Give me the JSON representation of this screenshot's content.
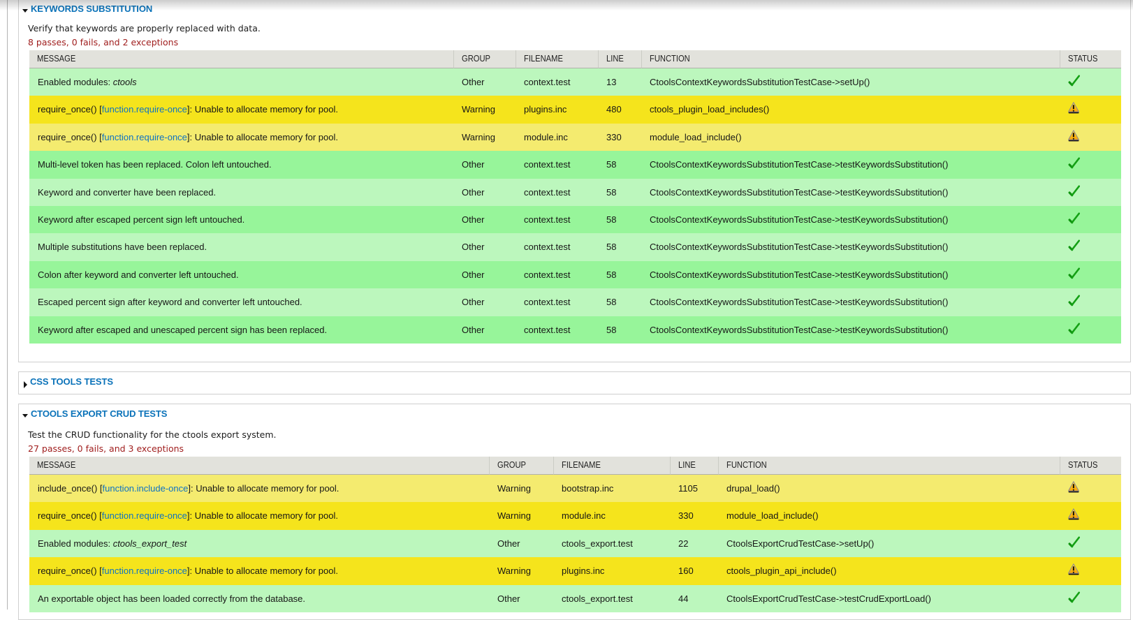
{
  "colors": {
    "pass_odd": "#bcf7bd",
    "pass_even": "#97f59a",
    "exception_odd": "#f4eb6f",
    "exception_even": "#f5e41c",
    "header_bg": "#e2e2dc",
    "title_blue": "#0a72b9",
    "link_blue": "#0d72c4",
    "summary_red": "#a01e1e",
    "check_green": "#1a9f1a",
    "warning_orange": "#f7a405"
  },
  "icons": {
    "expanded_arrow": "triangle-down",
    "collapsed_arrow": "triangle-right",
    "pass": "green-check",
    "exception": "yellow-warning-triangle"
  },
  "sections": [
    {
      "title": "KEYWORDS SUBSTITUTION",
      "collapsed": false,
      "description": "Verify that keywords are properly replaced with data.",
      "summary": "8 passes, 0 fails, and 2 exceptions",
      "columns": [
        "MESSAGE",
        "GROUP",
        "FILENAME",
        "LINE",
        "FUNCTION",
        "STATUS"
      ],
      "rows": [
        {
          "message": [
            {
              "t": "text",
              "v": "Enabled modules: "
            },
            {
              "t": "em",
              "v": "ctools"
            }
          ],
          "group": "Other",
          "filename": "context.test",
          "line": "13",
          "function": "CtoolsContextKeywordsSubstitutionTestCase->setUp()",
          "status": "pass"
        },
        {
          "message": [
            {
              "t": "text",
              "v": "require_once() ["
            },
            {
              "t": "link",
              "v": "function.require-once"
            },
            {
              "t": "text",
              "v": "]: Unable to allocate memory for pool."
            }
          ],
          "group": "Warning",
          "filename": "plugins.inc",
          "line": "480",
          "function": "ctools_plugin_load_includes()",
          "status": "exception"
        },
        {
          "message": [
            {
              "t": "text",
              "v": "require_once() ["
            },
            {
              "t": "link",
              "v": "function.require-once"
            },
            {
              "t": "text",
              "v": "]: Unable to allocate memory for pool."
            }
          ],
          "group": "Warning",
          "filename": "module.inc",
          "line": "330",
          "function": "module_load_include()",
          "status": "exception"
        },
        {
          "message": [
            {
              "t": "text",
              "v": "Multi-level token has been replaced. Colon left untouched."
            }
          ],
          "group": "Other",
          "filename": "context.test",
          "line": "58",
          "function": "CtoolsContextKeywordsSubstitutionTestCase->testKeywordsSubstitution()",
          "status": "pass"
        },
        {
          "message": [
            {
              "t": "text",
              "v": "Keyword and converter have been replaced."
            }
          ],
          "group": "Other",
          "filename": "context.test",
          "line": "58",
          "function": "CtoolsContextKeywordsSubstitutionTestCase->testKeywordsSubstitution()",
          "status": "pass"
        },
        {
          "message": [
            {
              "t": "text",
              "v": "Keyword after escaped percent sign left untouched."
            }
          ],
          "group": "Other",
          "filename": "context.test",
          "line": "58",
          "function": "CtoolsContextKeywordsSubstitutionTestCase->testKeywordsSubstitution()",
          "status": "pass"
        },
        {
          "message": [
            {
              "t": "text",
              "v": "Multiple substitutions have been replaced."
            }
          ],
          "group": "Other",
          "filename": "context.test",
          "line": "58",
          "function": "CtoolsContextKeywordsSubstitutionTestCase->testKeywordsSubstitution()",
          "status": "pass"
        },
        {
          "message": [
            {
              "t": "text",
              "v": "Colon after keyword and converter left untouched."
            }
          ],
          "group": "Other",
          "filename": "context.test",
          "line": "58",
          "function": "CtoolsContextKeywordsSubstitutionTestCase->testKeywordsSubstitution()",
          "status": "pass"
        },
        {
          "message": [
            {
              "t": "text",
              "v": "Escaped percent sign after keyword and converter left untouched."
            }
          ],
          "group": "Other",
          "filename": "context.test",
          "line": "58",
          "function": "CtoolsContextKeywordsSubstitutionTestCase->testKeywordsSubstitution()",
          "status": "pass"
        },
        {
          "message": [
            {
              "t": "text",
              "v": "Keyword after escaped and unescaped percent sign has been replaced."
            }
          ],
          "group": "Other",
          "filename": "context.test",
          "line": "58",
          "function": "CtoolsContextKeywordsSubstitutionTestCase->testKeywordsSubstitution()",
          "status": "pass"
        }
      ]
    },
    {
      "title": "CSS TOOLS TESTS",
      "collapsed": true
    },
    {
      "title": "CTOOLS EXPORT CRUD TESTS",
      "collapsed": false,
      "description": "Test the CRUD functionality for the ctools export system.",
      "summary": "27 passes, 0 fails, and 3 exceptions",
      "columns": [
        "MESSAGE",
        "GROUP",
        "FILENAME",
        "LINE",
        "FUNCTION",
        "STATUS"
      ],
      "rows": [
        {
          "message": [
            {
              "t": "text",
              "v": "include_once() ["
            },
            {
              "t": "link",
              "v": "function.include-once"
            },
            {
              "t": "text",
              "v": "]: Unable to allocate memory for pool."
            }
          ],
          "group": "Warning",
          "filename": "bootstrap.inc",
          "line": "1105",
          "function": "drupal_load()",
          "status": "exception"
        },
        {
          "message": [
            {
              "t": "text",
              "v": "require_once() ["
            },
            {
              "t": "link",
              "v": "function.require-once"
            },
            {
              "t": "text",
              "v": "]: Unable to allocate memory for pool."
            }
          ],
          "group": "Warning",
          "filename": "module.inc",
          "line": "330",
          "function": "module_load_include()",
          "status": "exception"
        },
        {
          "message": [
            {
              "t": "text",
              "v": "Enabled modules: "
            },
            {
              "t": "em",
              "v": "ctools_export_test"
            }
          ],
          "group": "Other",
          "filename": "ctools_export.test",
          "line": "22",
          "function": "CtoolsExportCrudTestCase->setUp()",
          "status": "pass"
        },
        {
          "message": [
            {
              "t": "text",
              "v": "require_once() ["
            },
            {
              "t": "link",
              "v": "function.require-once"
            },
            {
              "t": "text",
              "v": "]: Unable to allocate memory for pool."
            }
          ],
          "group": "Warning",
          "filename": "plugins.inc",
          "line": "160",
          "function": "ctools_plugin_api_include()",
          "status": "exception"
        },
        {
          "message": [
            {
              "t": "text",
              "v": "An exportable object has been loaded correctly from the database."
            }
          ],
          "group": "Other",
          "filename": "ctools_export.test",
          "line": "44",
          "function": "CtoolsExportCrudTestCase->testCrudExportLoad()",
          "status": "pass"
        }
      ]
    }
  ]
}
